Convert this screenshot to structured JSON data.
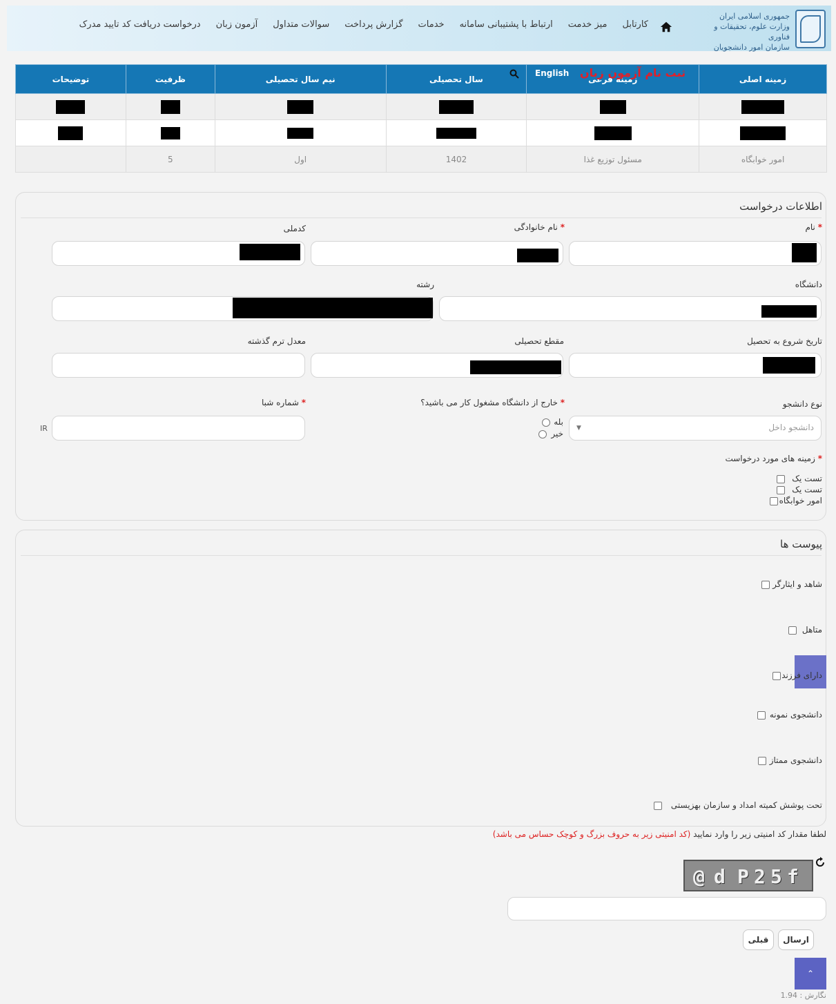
{
  "header": {
    "org_lines": [
      "جمهوری اسلامی ایران",
      "وزارت علوم، تحقیقات و فناوری",
      "سازمان امور دانشجویان"
    ],
    "nav": [
      "کارتابل",
      "میز خدمت",
      "ارتباط با پشتیبانی سامانه",
      "خدمات",
      "گزارش پرداخت",
      "سوالات متداول",
      "آزمون زبان",
      "درخواست دریافت کد تایید مدرک"
    ]
  },
  "table": {
    "headers": [
      "زمینه اصلی",
      "زمینه فرعی",
      "سال تحصیلی",
      "نیم سال تحصیلی",
      "ظرفیت",
      "توضیحات"
    ],
    "overlay_red": "ثبت نام آزمون زبان",
    "overlay_english": "English",
    "last_row": [
      "امور خوابگاه",
      "مسئول توزیع غذا",
      "1402",
      "اول",
      "5",
      ""
    ]
  },
  "request": {
    "title": "اطلاعات درخواست",
    "labels": {
      "first_name": "نام",
      "last_name": "نام خانوادگی",
      "national_code": "کدملی",
      "university": "دانشگاه",
      "major": "رشته",
      "start_date": "تاریخ شروع به تحصیل",
      "degree": "مقطع تحصیلی",
      "gpa": "معدل ترم گذشته",
      "student_type": "نوع دانشجو",
      "outside_work": "خارج از دانشگاه مشغول کار می باشید؟",
      "sheba": "شماره شبا",
      "fields": "زمینه های مورد درخواست"
    },
    "student_type_value": "دانشجو داخل",
    "radio_yes": "بله",
    "radio_no": "خیر",
    "sheba_prefix": "IR",
    "field_options": [
      "تست یک",
      "تست یک",
      "امور خوابگاه"
    ]
  },
  "attachments": {
    "title": "پیوست ها",
    "items": [
      "شاهد و ایثارگر",
      "متاهل",
      "دارای فرزند",
      "دانشجوی نمونه",
      "دانشجوی ممتاز",
      "تحت پوشش کمیته امداد و سازمان بهزیستی"
    ]
  },
  "captcha": {
    "prompt": "لطفا مقدار کد امنیتی زیر را وارد نمایید",
    "note": "(کد امنیتی زیر به حروف بزرگ و کوچک حساس می باشد)",
    "chars": [
      "@",
      "d",
      "P",
      "2",
      "5",
      "f"
    ]
  },
  "buttons": {
    "send": "ارسال",
    "prev": "قبلی"
  },
  "footer": {
    "version": "نگارش : 1.94"
  },
  "colors": {
    "table_header": "#1577b5",
    "accent_purple": "#5c63c3",
    "required": "#d22222"
  }
}
